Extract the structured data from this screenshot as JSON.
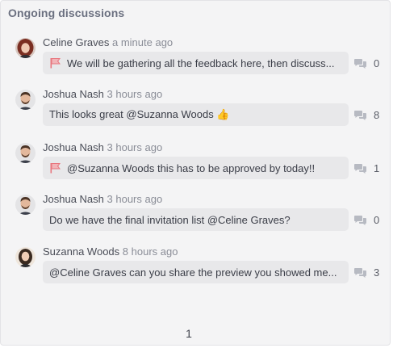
{
  "panel": {
    "title": "Ongoing discussions"
  },
  "discussions": [
    {
      "author": "Celine Graves",
      "time": "a minute ago",
      "message": "We will be gathering all the feedback here, then discuss...",
      "flagged": true,
      "replies": "0",
      "avatar": "celine-graves"
    },
    {
      "author": "Joshua Nash",
      "time": "3 hours ago",
      "message": "This looks great @Suzanna Woods 👍",
      "flagged": false,
      "replies": "8",
      "avatar": "joshua-nash"
    },
    {
      "author": "Joshua Nash",
      "time": "3 hours ago",
      "message": "@Suzanna Woods this has to be approved by today!!",
      "flagged": true,
      "replies": "1",
      "avatar": "joshua-nash"
    },
    {
      "author": "Joshua Nash",
      "time": "3 hours ago",
      "message": "Do we have the final invitation list @Celine Graves?",
      "flagged": false,
      "replies": "0",
      "avatar": "joshua-nash"
    },
    {
      "author": "Suzanna Woods",
      "time": "8 hours ago",
      "message": "@Celine Graves can you share the preview you showed me...",
      "flagged": false,
      "replies": "3",
      "avatar": "suzanna-woods"
    }
  ],
  "pagination": {
    "current": "1"
  },
  "colors": {
    "flag": "#e8767e",
    "comment_icon": "#b7bac2",
    "panel_background": "#f4f4f5",
    "bubble_background": "#e8e8ea"
  },
  "icons": {
    "flag": "flag-icon",
    "replies": "comment-icon"
  }
}
